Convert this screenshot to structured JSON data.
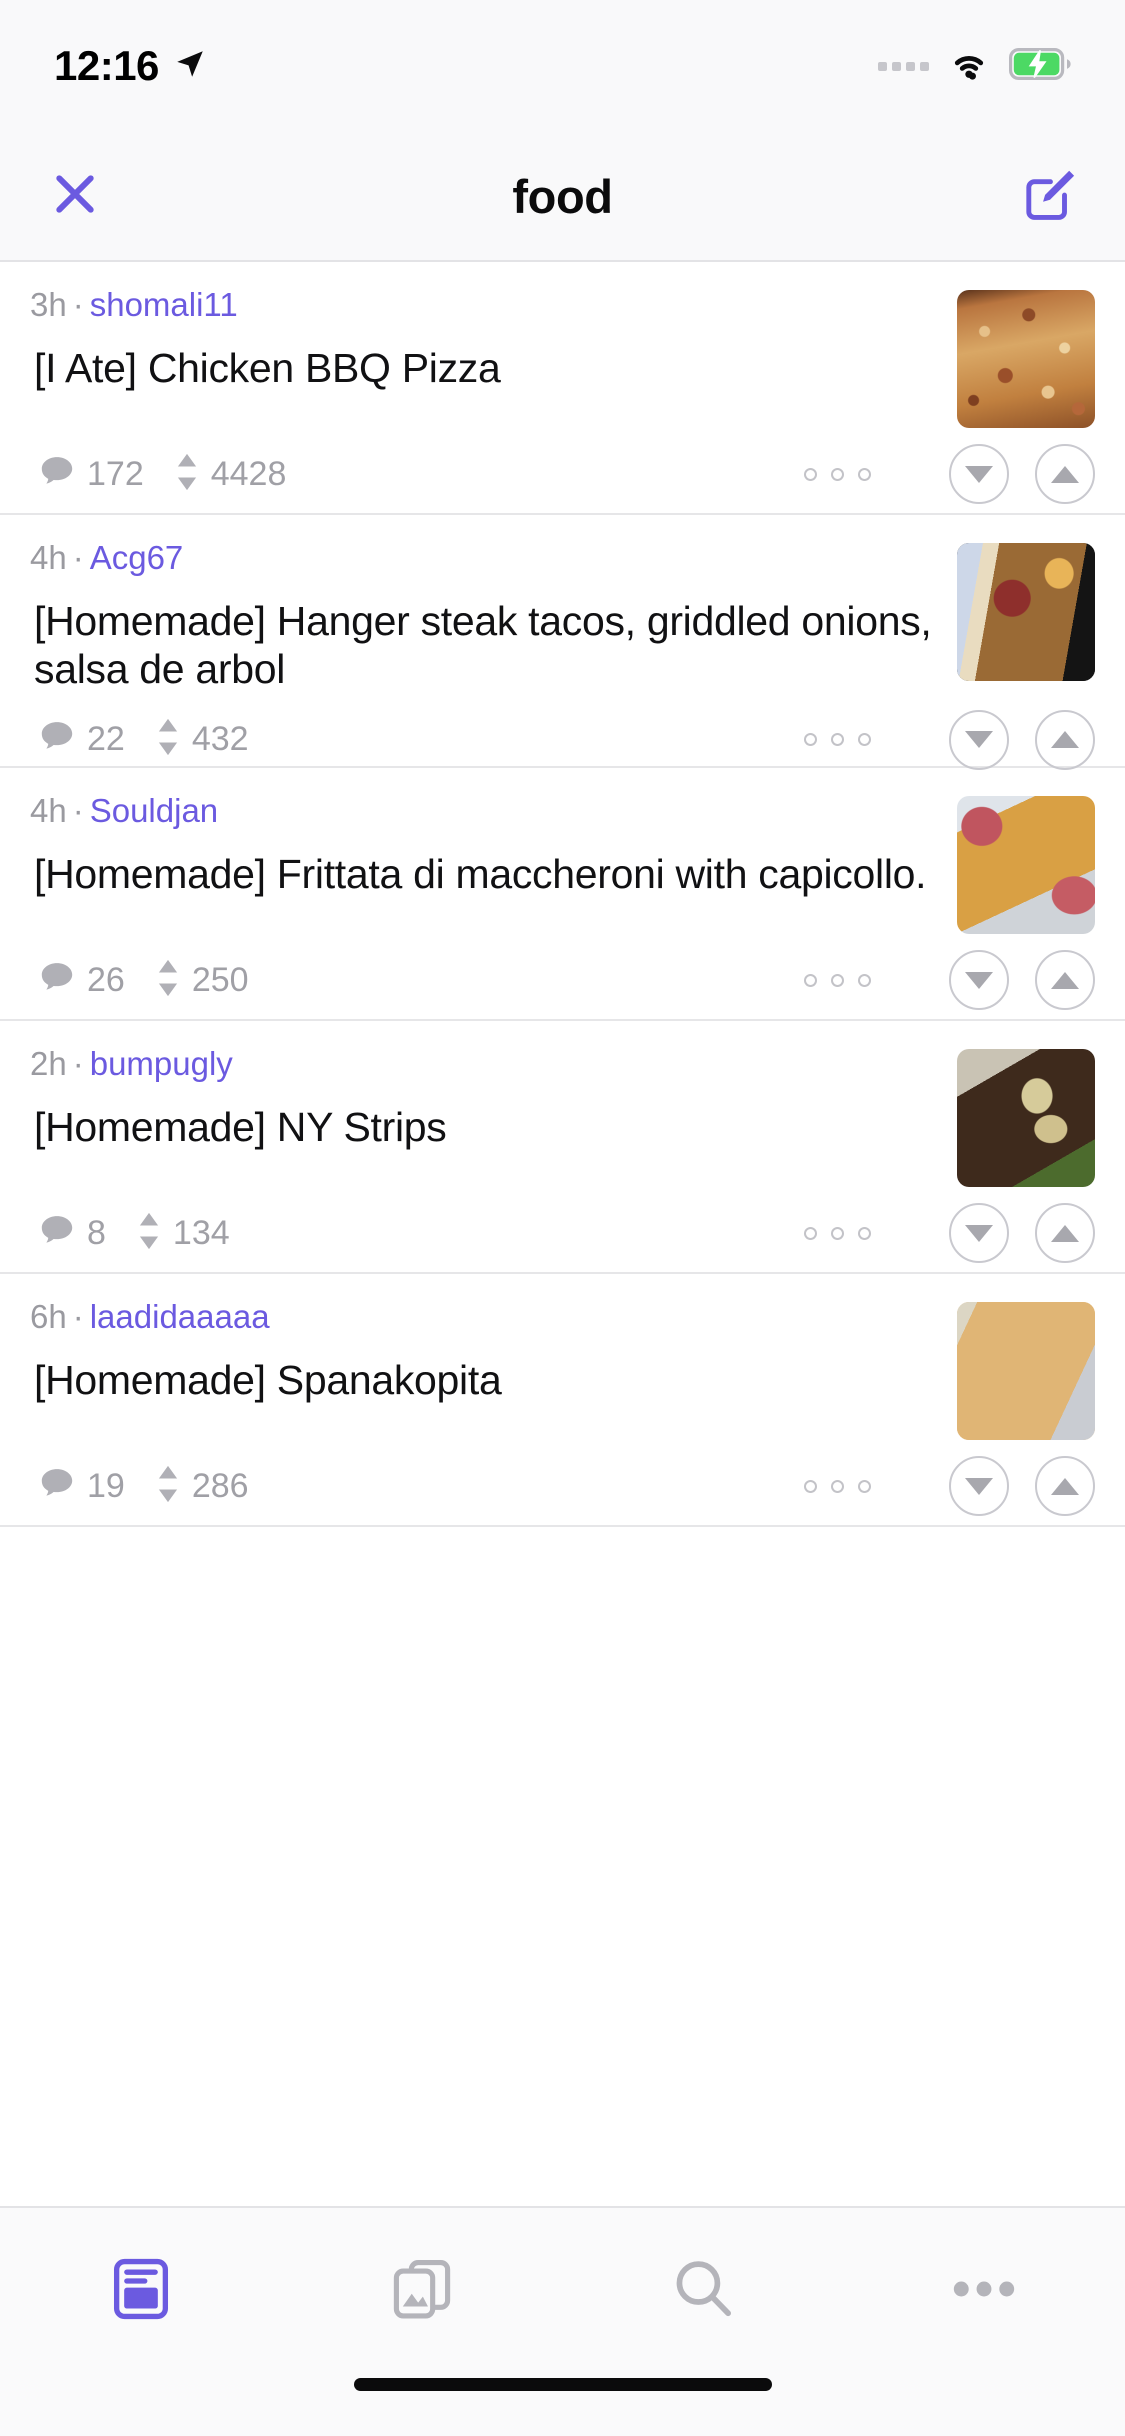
{
  "status_bar": {
    "time": "12:16",
    "location_icon": "location-arrow-icon",
    "signal_icon": "signal-dots-icon",
    "wifi_icon": "wifi-icon",
    "battery_icon": "battery-charging-icon",
    "battery_color": "#4cd964"
  },
  "nav": {
    "close_icon": "close-icon",
    "title": "food",
    "compose_icon": "compose-icon",
    "accent_color": "#6b5ae0"
  },
  "posts": [
    {
      "age": "3h",
      "separator": "·",
      "user": "shomali11",
      "title": "[I Ate] Chicken BBQ Pizza",
      "comments": "172",
      "score": "4428",
      "thumb_class": "art-pizza",
      "thumb_alt": "chicken-bbq-pizza-thumbnail"
    },
    {
      "age": "4h",
      "separator": "·",
      "user": "Acg67",
      "title": "[Homemade] Hanger steak tacos, griddled onions, salsa de arbol",
      "comments": "22",
      "score": "432",
      "thumb_class": "art-tacos",
      "thumb_alt": "hanger-steak-tacos-thumbnail"
    },
    {
      "age": "4h",
      "separator": "·",
      "user": "Souldjan",
      "title": "[Homemade] Frittata di maccheroni with capicollo.",
      "comments": "26",
      "score": "250",
      "thumb_class": "art-frittata",
      "thumb_alt": "frittata-di-maccheroni-thumbnail"
    },
    {
      "age": "2h",
      "separator": "·",
      "user": "bumpugly",
      "title": "[Homemade] NY Strips",
      "comments": "8",
      "score": "134",
      "thumb_class": "art-steak",
      "thumb_alt": "ny-strips-thumbnail"
    },
    {
      "age": "6h",
      "separator": "·",
      "user": "laadidaaaaa",
      "title": "[Homemade] Spanakopita",
      "comments": "19",
      "score": "286",
      "thumb_class": "art-spanakopita",
      "thumb_alt": "spanakopita-thumbnail"
    }
  ],
  "post_actions": {
    "comment_icon": "comment-bubble-icon",
    "score_icon": "up-down-arrows-icon",
    "more_icon": "more-options-icon",
    "downvote_icon": "downvote-icon",
    "upvote_icon": "upvote-icon"
  },
  "tabbar": {
    "items": [
      {
        "icon": "feed-card-icon",
        "active": true
      },
      {
        "icon": "gallery-images-icon",
        "active": false
      },
      {
        "icon": "search-icon",
        "active": false
      },
      {
        "icon": "more-dots-icon",
        "active": false
      }
    ],
    "active_color": "#6b5ae0",
    "inactive_color": "#b4b4ba"
  }
}
